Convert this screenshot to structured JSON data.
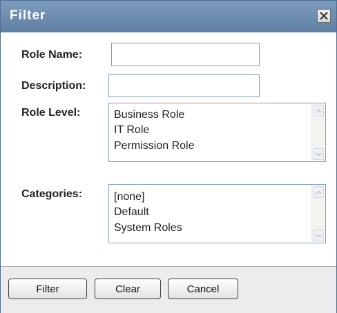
{
  "dialog": {
    "title": "Filter",
    "close_icon": "close-x-icon"
  },
  "fields": {
    "role_name": {
      "label": "Role Name:",
      "value": ""
    },
    "description": {
      "label": "Description:",
      "value": ""
    }
  },
  "role_level": {
    "label": "Role Level:",
    "options": [
      "Business Role",
      "IT Role",
      "Permission Role"
    ]
  },
  "categories": {
    "label": "Categories:",
    "options": [
      "[none]",
      "Default",
      "System Roles"
    ]
  },
  "buttons": {
    "filter": "Filter",
    "clear": "Clear",
    "cancel": "Cancel"
  }
}
